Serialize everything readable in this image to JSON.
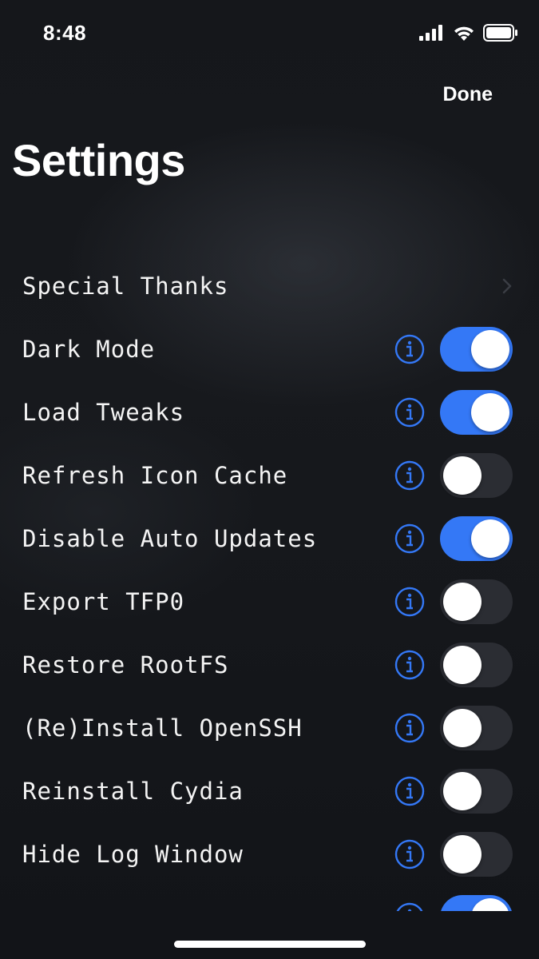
{
  "status_bar": {
    "time": "8:48"
  },
  "nav": {
    "done_label": "Done"
  },
  "page": {
    "title": "Settings"
  },
  "colors": {
    "accent": "#3478f6",
    "toggle_off": "#2b2d33",
    "background": "#131519"
  },
  "rows": [
    {
      "label": "Special Thanks",
      "type": "link"
    },
    {
      "label": "Dark Mode",
      "type": "toggle",
      "on": true
    },
    {
      "label": "Load Tweaks",
      "type": "toggle",
      "on": true
    },
    {
      "label": "Refresh Icon Cache",
      "type": "toggle",
      "on": false
    },
    {
      "label": "Disable Auto Updates",
      "type": "toggle",
      "on": true
    },
    {
      "label": "Export TFP0",
      "type": "toggle",
      "on": false
    },
    {
      "label": "Restore RootFS",
      "type": "toggle",
      "on": false
    },
    {
      "label": "(Re)Install OpenSSH",
      "type": "toggle",
      "on": false
    },
    {
      "label": "Reinstall Cydia",
      "type": "toggle",
      "on": false
    },
    {
      "label": "Hide Log Window",
      "type": "toggle",
      "on": false
    },
    {
      "label": "",
      "type": "toggle",
      "on": true
    }
  ]
}
